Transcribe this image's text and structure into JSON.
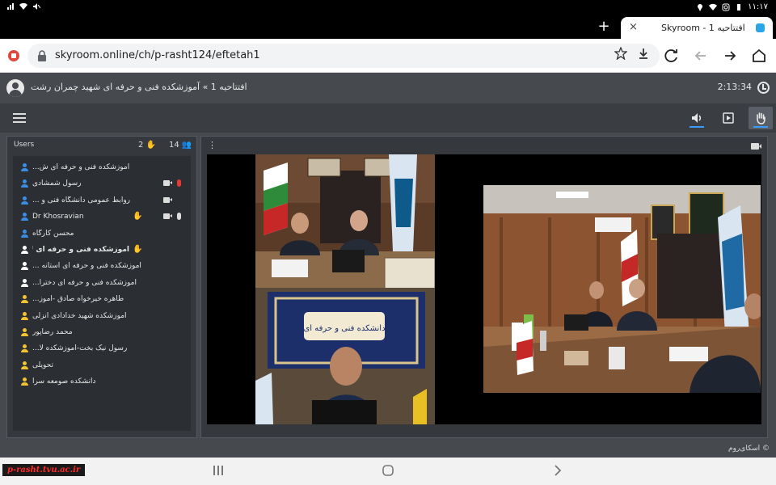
{
  "status_bar": {
    "time": "۱۱:۱۷"
  },
  "browser": {
    "new_tab_glyph": "+",
    "tab": {
      "title": "Skyroom - افتتاحیه 1",
      "close_glyph": "×"
    },
    "url": "skyroom.online/ch/p-rasht124/eftetah1"
  },
  "room": {
    "title": "افتتاحیه 1 » آموزشکده فنی و حرفه ای شهید چمران رشت",
    "timer": "2:13:34"
  },
  "users_panel": {
    "label": "Users",
    "raised_hands": "2",
    "user_count": "14",
    "users": [
      {
        "name": "آموزشکده فنی و حرفه ای ش...",
        "color": "#3a8ee6",
        "camera": false,
        "mic": "",
        "hand": false,
        "bold": false,
        "ltr": false
      },
      {
        "name": "رسول شمشادی",
        "color": "#3a8ee6",
        "camera": true,
        "mic": "#e53935",
        "hand": false,
        "bold": false,
        "ltr": false
      },
      {
        "name": "روابط عمومی دانشگاه فنی و ...",
        "color": "#3a8ee6",
        "camera": true,
        "mic": "",
        "hand": false,
        "bold": false,
        "ltr": false
      },
      {
        "name": "Dr Khosravian",
        "color": "#3a8ee6",
        "camera": true,
        "mic": "#dddddd",
        "hand": true,
        "bold": false,
        "ltr": true
      },
      {
        "name": "محسن کارگاه",
        "color": "#3a8ee6",
        "camera": false,
        "mic": "",
        "hand": false,
        "bold": false,
        "ltr": false
      },
      {
        "name": "آموزشکده فنی و حرفه ای لاهیجا...",
        "color": "#ffffff",
        "camera": false,
        "mic": "",
        "hand": true,
        "bold": true,
        "ltr": false
      },
      {
        "name": "آموزشکده فنی و حرفه ای آستانه ...",
        "color": "#ffffff",
        "camera": false,
        "mic": "",
        "hand": false,
        "bold": false,
        "ltr": false
      },
      {
        "name": "آموزشکده فنی و حرفه ای دخترا...",
        "color": "#ffffff",
        "camera": false,
        "mic": "",
        "hand": false,
        "bold": false,
        "ltr": false
      },
      {
        "name": "طاهره خیرخواه صادق -آموز...",
        "color": "#f2c230",
        "camera": false,
        "mic": "",
        "hand": false,
        "bold": false,
        "ltr": false
      },
      {
        "name": "آموزشکده شهید خدادادی انزلی",
        "color": "#f2c230",
        "camera": false,
        "mic": "",
        "hand": false,
        "bold": false,
        "ltr": false
      },
      {
        "name": "محمد رضاپور",
        "color": "#f2c230",
        "camera": false,
        "mic": "",
        "hand": false,
        "bold": false,
        "ltr": false
      },
      {
        "name": "رسول نیک بخت-آموزشکده لا...",
        "color": "#f2c230",
        "camera": false,
        "mic": "",
        "hand": false,
        "bold": false,
        "ltr": false
      },
      {
        "name": "تحویلی",
        "color": "#f2c230",
        "camera": false,
        "mic": "",
        "hand": false,
        "bold": false,
        "ltr": false
      },
      {
        "name": "دانشکده صومعه سرا",
        "color": "#f2c230",
        "camera": false,
        "mic": "",
        "hand": false,
        "bold": false,
        "ltr": false
      }
    ]
  },
  "video_panel": {
    "menu_glyph": "⋮",
    "banner_text": "دانشکده فنی و حرفه ای"
  },
  "footer": {
    "copyright": "اسکای‌روم ©"
  },
  "watermark": "p-rasht.tvu.ac.ir",
  "colors": {
    "accent": "#3b9bff",
    "header_bg": "#46494e",
    "panel_bg": "#35383d"
  }
}
